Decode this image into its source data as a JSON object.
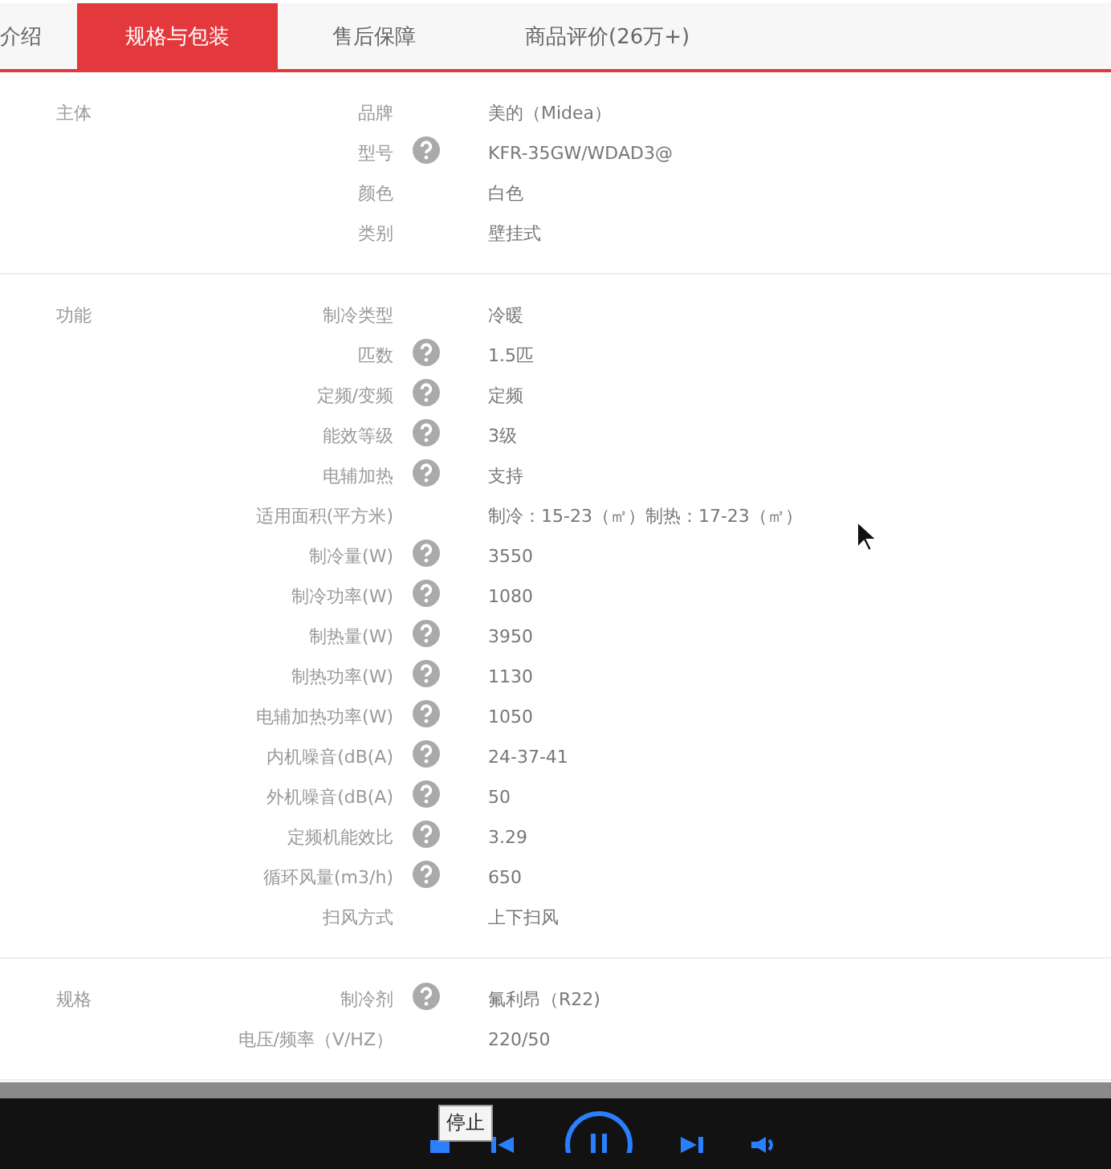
{
  "tabs": [
    {
      "label": "介绍",
      "selected": false
    },
    {
      "label": "规格与包装",
      "selected": true
    },
    {
      "label": "售后保障",
      "selected": false
    },
    {
      "label": "商品评价(26万+)",
      "selected": false
    }
  ],
  "spec_groups": [
    {
      "title": "主体",
      "rows": [
        {
          "key": "品牌",
          "help": false,
          "value": "美的（Midea）"
        },
        {
          "key": "型号",
          "help": true,
          "value": "KFR-35GW/WDAD3@"
        },
        {
          "key": "颜色",
          "help": false,
          "value": "白色"
        },
        {
          "key": "类别",
          "help": false,
          "value": "壁挂式"
        }
      ]
    },
    {
      "title": "功能",
      "rows": [
        {
          "key": "制冷类型",
          "help": false,
          "value": "冷暖"
        },
        {
          "key": "匹数",
          "help": true,
          "value": "1.5匹"
        },
        {
          "key": "定频/变频",
          "help": true,
          "value": "定频"
        },
        {
          "key": "能效等级",
          "help": true,
          "value": "3级"
        },
        {
          "key": "电辅加热",
          "help": true,
          "value": "支持"
        },
        {
          "key": "适用面积(平方米)",
          "help": false,
          "value": "制冷：15-23（㎡）制热：17-23（㎡）"
        },
        {
          "key": "制冷量(W)",
          "help": true,
          "value": "3550"
        },
        {
          "key": "制冷功率(W)",
          "help": true,
          "value": "1080"
        },
        {
          "key": "制热量(W)",
          "help": true,
          "value": "3950"
        },
        {
          "key": "制热功率(W)",
          "help": true,
          "value": "1130"
        },
        {
          "key": "电辅加热功率(W)",
          "help": true,
          "value": "1050"
        },
        {
          "key": "内机噪音(dB(A)",
          "help": true,
          "value": "24-37-41"
        },
        {
          "key": "外机噪音(dB(A)",
          "help": true,
          "value": "50"
        },
        {
          "key": "定频机能效比",
          "help": true,
          "value": "3.29"
        },
        {
          "key": "循环风量(m3/h)",
          "help": true,
          "value": "650"
        },
        {
          "key": "扫风方式",
          "help": false,
          "value": "上下扫风"
        }
      ]
    },
    {
      "title": "规格",
      "rows": [
        {
          "key": "制冷剂",
          "help": true,
          "value": "氟利昂（R22)"
        },
        {
          "key": "电压/频率（V/HZ）",
          "help": false,
          "value": "220/50"
        }
      ]
    }
  ],
  "player": {
    "tooltip": "停止"
  }
}
